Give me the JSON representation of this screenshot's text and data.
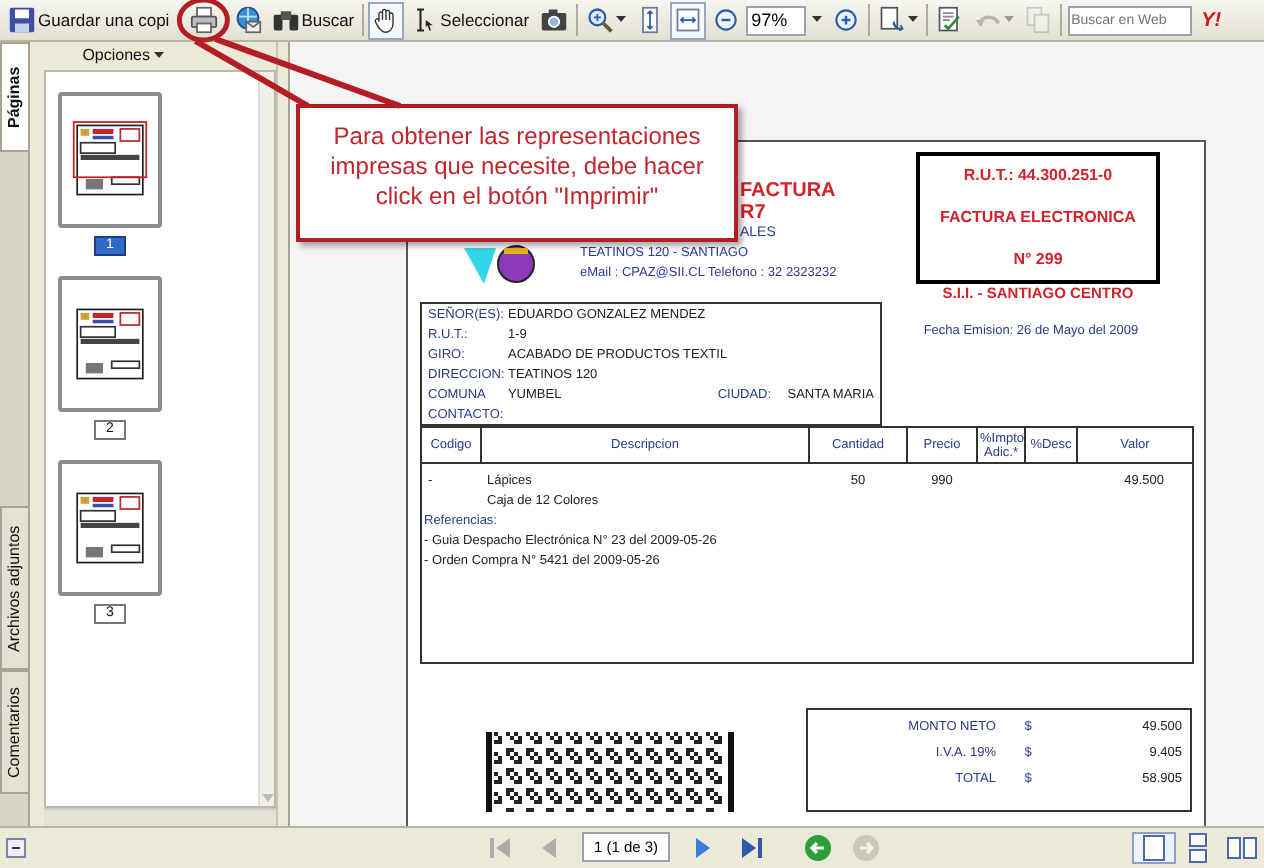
{
  "toolbar": [
    {
      "kind": "save",
      "label": "Guardar una copi"
    },
    {
      "kind": "print",
      "highlighted": true
    },
    {
      "kind": "email"
    },
    {
      "kind": "find",
      "label": "Buscar"
    },
    {
      "kind": "separator"
    },
    {
      "kind": "hand",
      "pressed": true
    },
    {
      "kind": "select",
      "label": "Seleccionar",
      "pressed": false
    },
    {
      "kind": "snapshot",
      "pressed": false
    },
    {
      "kind": "separator"
    },
    {
      "kind": "zoomtool",
      "menu": true
    },
    {
      "kind": "fitpage",
      "pressed": false
    },
    {
      "kind": "fitwidth",
      "pressed": true
    },
    {
      "kind": "zoomout"
    },
    {
      "kind": "zoomfield",
      "value": "97%",
      "menu": true
    },
    {
      "kind": "zoomin"
    },
    {
      "kind": "separator"
    },
    {
      "kind": "pagemenu",
      "menu": true
    },
    {
      "kind": "separator"
    },
    {
      "kind": "sign"
    },
    {
      "kind": "undo",
      "menu": true,
      "disabled": true
    },
    {
      "kind": "copy",
      "disabled": true
    },
    {
      "kind": "separator"
    },
    {
      "kind": "websearch",
      "placeholder": "Buscar en Web"
    },
    {
      "kind": "logo",
      "label": "Y!"
    }
  ],
  "callout": {
    "text": "Para obtener las representaciones impresas que necesite, debe hacer click en el botón \"Imprimir\""
  },
  "side_tabs": [
    {
      "label": "Páginas",
      "selected": true
    },
    {
      "label": "Archivos adjuntos",
      "selected": false
    },
    {
      "label": "Comentarios",
      "selected": false
    }
  ],
  "pages_panel": {
    "options": "Opciones",
    "thumbnails": [
      {
        "label": "1",
        "selected": true
      },
      {
        "label": "2",
        "selected": false
      },
      {
        "label": "3",
        "selected": false
      }
    ]
  },
  "document": {
    "issuer_lines": [
      {
        "kind": "partial_title",
        "text": "FACTURA"
      },
      {
        "kind": "partial_title",
        "text": "R7"
      },
      {
        "kind": "partial_info",
        "text": "ALES"
      },
      {
        "kind": "info",
        "text": "TEATINOS 120 - SANTIAGO"
      },
      {
        "kind": "info",
        "text": "eMail : CPAZ@SII.CL Telefono : 32 2323232"
      }
    ],
    "rut_box": [
      "R.U.T.: 44.300.251-0",
      "FACTURA ELECTRONICA",
      "N° 299"
    ],
    "office": "S.I.I. - SANTIAGO CENTRO",
    "issue_date": "Fecha Emision: 26 de Mayo del 2009",
    "customer": [
      {
        "label": "SEÑOR(ES):",
        "value": "EDUARDO GONZALEZ MENDEZ"
      },
      {
        "label": "R.U.T.:",
        "value": "1-9"
      },
      {
        "label": "GIRO:",
        "value": "ACABADO DE PRODUCTOS TEXTIL"
      },
      {
        "label": "DIRECCION:",
        "value": "TEATINOS 120"
      },
      {
        "label": "COMUNA",
        "value": "YUMBEL",
        "extra_label": "CIUDAD:",
        "extra_value": "SANTA MARIA"
      },
      {
        "label": "CONTACTO:"
      }
    ],
    "items": {
      "columns": [
        "Codigo",
        "Descripcion",
        "Cantidad",
        "Precio",
        "%Impto Adic.*",
        "%Desc",
        "Valor"
      ],
      "rows": [
        {
          "code": "-",
          "description": [
            "Lápices",
            "Caja de 12 Colores"
          ],
          "quantity": "50",
          "price": "990",
          "value": "49.500"
        }
      ]
    },
    "references": {
      "title": "Referencias:",
      "lines": [
        "- Guia Despacho Electrónica N° 23 del 2009-05-26",
        "- Orden Compra N° 5421 del 2009-05-26"
      ]
    },
    "totals": [
      {
        "label": "MONTO NETO",
        "currency": "$",
        "value": "49.500"
      },
      {
        "label": "I.V.A. 19%",
        "currency": "$",
        "value": "9.405"
      },
      {
        "label": "TOTAL",
        "currency": "$",
        "value": "58.905"
      }
    ]
  },
  "navigation": [
    {
      "kind": "first",
      "disabled": true
    },
    {
      "kind": "prev",
      "disabled": true
    },
    {
      "kind": "page",
      "value": "1 (1 de 3)"
    },
    {
      "kind": "next",
      "disabled": false
    },
    {
      "kind": "last",
      "disabled": false
    },
    {
      "kind": "back",
      "disabled": false
    },
    {
      "kind": "forward",
      "disabled": true
    }
  ],
  "view_modes": [
    {
      "kind": "single",
      "selected": true
    },
    {
      "kind": "continuous",
      "selected": false
    },
    {
      "kind": "facing",
      "selected": false
    }
  ]
}
